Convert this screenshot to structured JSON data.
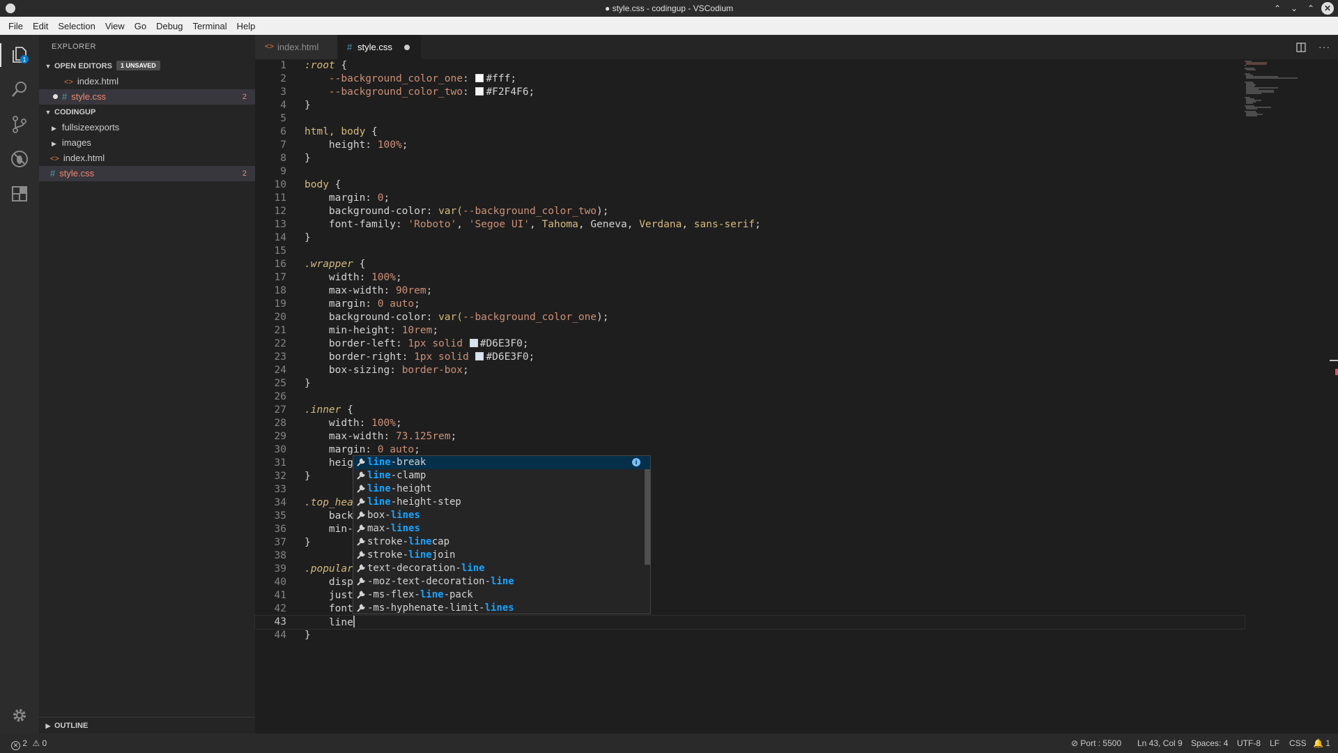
{
  "window": {
    "title": "● style.css - codingup - VSCodium"
  },
  "menu": [
    "File",
    "Edit",
    "Selection",
    "View",
    "Go",
    "Debug",
    "Terminal",
    "Help"
  ],
  "activity_bar": {
    "scm_badge": "1"
  },
  "explorer": {
    "title": "EXPLORER",
    "open_editors_label": "OPEN EDITORS",
    "unsaved_badge": "1 UNSAVED",
    "open_editors": [
      {
        "name": "index.html",
        "type": "html"
      },
      {
        "name": "style.css",
        "type": "css",
        "count": "2"
      }
    ],
    "folder_label": "CODINGUP",
    "items": [
      {
        "name": "fullsizeexports",
        "type": "folder"
      },
      {
        "name": "images",
        "type": "folder"
      },
      {
        "name": "index.html",
        "type": "html"
      },
      {
        "name": "style.css",
        "type": "css",
        "count": "2"
      }
    ],
    "outline_label": "OUTLINE"
  },
  "tabs": [
    {
      "label": "index.html",
      "icon": "<>"
    },
    {
      "label": "style.css",
      "icon": "#"
    }
  ],
  "code_lines": [
    [
      {
        "t": ":root",
        "c": "#d7ba7d",
        "i": true
      },
      {
        "t": " {",
        "c": "#d4d4d4"
      }
    ],
    [
      {
        "t": "    --background_color_one",
        "c": "#ce9178"
      },
      {
        "t": ": ",
        "c": "#d4d4d4"
      },
      {
        "sw": "#ffffff"
      },
      {
        "t": "#fff;",
        "c": "#d4d4d4"
      }
    ],
    [
      {
        "t": "    --background_color_two",
        "c": "#ce9178"
      },
      {
        "t": ": ",
        "c": "#d4d4d4"
      },
      {
        "sw": "#F2F4F6"
      },
      {
        "t": "#F2F4F6;",
        "c": "#d4d4d4"
      }
    ],
    [
      {
        "t": "}",
        "c": "#d4d4d4"
      }
    ],
    [],
    [
      {
        "t": "html, body",
        "c": "#d7ba7d"
      },
      {
        "t": " {",
        "c": "#d4d4d4"
      }
    ],
    [
      {
        "t": "    height: ",
        "c": "#d4d4d4"
      },
      {
        "t": "100%",
        "c": "#ce9178"
      },
      {
        "t": ";",
        "c": "#d4d4d4"
      }
    ],
    [
      {
        "t": "}",
        "c": "#d4d4d4"
      }
    ],
    [],
    [
      {
        "t": "body",
        "c": "#d7ba7d"
      },
      {
        "t": " {",
        "c": "#d4d4d4"
      }
    ],
    [
      {
        "t": "    margin: ",
        "c": "#d4d4d4"
      },
      {
        "t": "0",
        "c": "#ce9178"
      },
      {
        "t": ";",
        "c": "#d4d4d4"
      }
    ],
    [
      {
        "t": "    background-color: ",
        "c": "#d4d4d4"
      },
      {
        "t": "var(",
        "c": "#d7ba7d"
      },
      {
        "t": "--background_color_two",
        "c": "#ce9178"
      },
      {
        "t": ");",
        "c": "#d4d4d4"
      }
    ],
    [
      {
        "t": "    font-family: ",
        "c": "#d4d4d4"
      },
      {
        "t": "'Roboto'",
        "c": "#ce9178"
      },
      {
        "t": ", ",
        "c": "#d4d4d4"
      },
      {
        "t": "'Segoe UI'",
        "c": "#ce9178"
      },
      {
        "t": ", ",
        "c": "#d4d4d4"
      },
      {
        "t": "Tahoma",
        "c": "#d7ba7d"
      },
      {
        "t": ", Geneva, ",
        "c": "#d4d4d4"
      },
      {
        "t": "Verdana",
        "c": "#d7ba7d"
      },
      {
        "t": ", ",
        "c": "#d4d4d4"
      },
      {
        "t": "sans-serif",
        "c": "#d7ba7d"
      },
      {
        "t": ";",
        "c": "#d4d4d4"
      }
    ],
    [
      {
        "t": "}",
        "c": "#d4d4d4"
      }
    ],
    [],
    [
      {
        "t": ".wrapper",
        "c": "#d7ba7d",
        "i": true
      },
      {
        "t": " {",
        "c": "#d4d4d4"
      }
    ],
    [
      {
        "t": "    width: ",
        "c": "#d4d4d4"
      },
      {
        "t": "100%",
        "c": "#ce9178"
      },
      {
        "t": ";",
        "c": "#d4d4d4"
      }
    ],
    [
      {
        "t": "    max-width: ",
        "c": "#d4d4d4"
      },
      {
        "t": "90rem",
        "c": "#ce9178"
      },
      {
        "t": ";",
        "c": "#d4d4d4"
      }
    ],
    [
      {
        "t": "    margin: ",
        "c": "#d4d4d4"
      },
      {
        "t": "0 auto",
        "c": "#ce9178"
      },
      {
        "t": ";",
        "c": "#d4d4d4"
      }
    ],
    [
      {
        "t": "    background-color: ",
        "c": "#d4d4d4"
      },
      {
        "t": "var(",
        "c": "#d7ba7d"
      },
      {
        "t": "--background_color_one",
        "c": "#ce9178"
      },
      {
        "t": ");",
        "c": "#d4d4d4"
      }
    ],
    [
      {
        "t": "    min-height: ",
        "c": "#d4d4d4"
      },
      {
        "t": "10rem",
        "c": "#ce9178"
      },
      {
        "t": ";",
        "c": "#d4d4d4"
      }
    ],
    [
      {
        "t": "    border-left: ",
        "c": "#d4d4d4"
      },
      {
        "t": "1px solid ",
        "c": "#ce9178"
      },
      {
        "sw": "#D6E3F0"
      },
      {
        "t": "#D6E3F0;",
        "c": "#d4d4d4"
      }
    ],
    [
      {
        "t": "    border-right: ",
        "c": "#d4d4d4"
      },
      {
        "t": "1px solid ",
        "c": "#ce9178"
      },
      {
        "sw": "#D6E3F0"
      },
      {
        "t": "#D6E3F0;",
        "c": "#d4d4d4"
      }
    ],
    [
      {
        "t": "    box-sizing: ",
        "c": "#d4d4d4"
      },
      {
        "t": "border-box",
        "c": "#ce9178"
      },
      {
        "t": ";",
        "c": "#d4d4d4"
      }
    ],
    [
      {
        "t": "}",
        "c": "#d4d4d4"
      }
    ],
    [],
    [
      {
        "t": ".inner",
        "c": "#d7ba7d",
        "i": true
      },
      {
        "t": " {",
        "c": "#d4d4d4"
      }
    ],
    [
      {
        "t": "    width: ",
        "c": "#d4d4d4"
      },
      {
        "t": "100%",
        "c": "#ce9178"
      },
      {
        "t": ";",
        "c": "#d4d4d4"
      }
    ],
    [
      {
        "t": "    max-width: ",
        "c": "#d4d4d4"
      },
      {
        "t": "73.125rem",
        "c": "#ce9178"
      },
      {
        "t": ";",
        "c": "#d4d4d4"
      }
    ],
    [
      {
        "t": "    margin: ",
        "c": "#d4d4d4"
      },
      {
        "t": "0 auto",
        "c": "#ce9178"
      },
      {
        "t": ";",
        "c": "#d4d4d4"
      }
    ],
    [
      {
        "t": "    heig",
        "c": "#d4d4d4"
      }
    ],
    [
      {
        "t": "}",
        "c": "#d4d4d4"
      }
    ],
    [],
    [
      {
        "t": ".top_hea",
        "c": "#d7ba7d",
        "i": true
      }
    ],
    [
      {
        "t": "    back",
        "c": "#d4d4d4"
      }
    ],
    [
      {
        "t": "    min-",
        "c": "#d4d4d4"
      }
    ],
    [
      {
        "t": "}",
        "c": "#d4d4d4"
      }
    ],
    [],
    [
      {
        "t": ".popular",
        "c": "#d7ba7d",
        "i": true
      }
    ],
    [
      {
        "t": "    disp",
        "c": "#d4d4d4"
      }
    ],
    [
      {
        "t": "    just",
        "c": "#d4d4d4"
      }
    ],
    [
      {
        "t": "    font",
        "c": "#d4d4d4"
      }
    ],
    [
      {
        "t": "    line",
        "c": "#d4d4d4"
      }
    ],
    [
      {
        "t": "}",
        "c": "#d4d4d4"
      }
    ]
  ],
  "current_line": 43,
  "suggestions": [
    [
      {
        "t": "line",
        "h": true
      },
      {
        "t": "-break"
      }
    ],
    [
      {
        "t": "line",
        "h": true
      },
      {
        "t": "-clamp"
      }
    ],
    [
      {
        "t": "line",
        "h": true
      },
      {
        "t": "-height"
      }
    ],
    [
      {
        "t": "line",
        "h": true
      },
      {
        "t": "-height-step"
      }
    ],
    [
      {
        "t": "box-"
      },
      {
        "t": "line",
        "h": true
      },
      {
        "t": "s",
        "h": true
      }
    ],
    [
      {
        "t": "max-"
      },
      {
        "t": "line",
        "h": true
      },
      {
        "t": "s",
        "h": true
      }
    ],
    [
      {
        "t": "stroke-"
      },
      {
        "t": "line",
        "h": true
      },
      {
        "t": "cap"
      }
    ],
    [
      {
        "t": "stroke-"
      },
      {
        "t": "line",
        "h": true
      },
      {
        "t": "join"
      }
    ],
    [
      {
        "t": "text-decoration-"
      },
      {
        "t": "line",
        "h": true
      }
    ],
    [
      {
        "t": "-moz-text-decoration-"
      },
      {
        "t": "line",
        "h": true
      }
    ],
    [
      {
        "t": "-ms-flex-"
      },
      {
        "t": "line",
        "h": true
      },
      {
        "t": "-pack"
      }
    ],
    [
      {
        "t": "-ms-hyphenate-limit-"
      },
      {
        "t": "line",
        "h": true
      },
      {
        "t": "s",
        "h": true
      }
    ]
  ],
  "status": {
    "errors": "2",
    "warnings": "0",
    "port": "Port : 5500",
    "position": "Ln 43, Col 9",
    "spaces": "Spaces: 4",
    "encoding": "UTF-8",
    "eol": "LF",
    "language": "CSS",
    "notifications": "1"
  }
}
